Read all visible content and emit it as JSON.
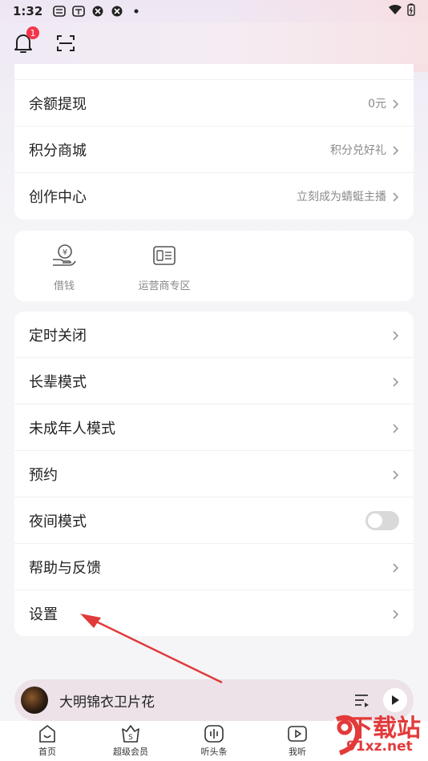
{
  "status_bar": {
    "time": "1:32"
  },
  "header": {
    "notification_count": "1"
  },
  "account_card": {
    "items": [
      {
        "label": "余额提现",
        "value": "0元"
      },
      {
        "label": "积分商城",
        "value": "积分兑好礼"
      },
      {
        "label": "创作中心",
        "value": "立刻成为蜻蜓主播"
      }
    ]
  },
  "services": {
    "items": [
      {
        "label": "借钱",
        "icon": "loan-icon"
      },
      {
        "label": "运营商专区",
        "icon": "carrier-icon"
      }
    ]
  },
  "settings_card": {
    "items": [
      {
        "label": "定时关闭"
      },
      {
        "label": "长辈模式"
      },
      {
        "label": "未成年人模式"
      },
      {
        "label": "预约"
      },
      {
        "label": "夜间模式",
        "toggle": false
      },
      {
        "label": "帮助与反馈"
      },
      {
        "label": "设置"
      }
    ]
  },
  "player": {
    "title": "大明锦衣卫片花"
  },
  "tabbar": {
    "items": [
      {
        "label": "首页"
      },
      {
        "label": "超级会员"
      },
      {
        "label": "听头条"
      },
      {
        "label": "我听"
      }
    ]
  },
  "watermark": {
    "text_top": "下载站",
    "text_bottom": "91xz.net",
    "mark": "9"
  },
  "colors": {
    "accent": "#f5344a",
    "annotation_arrow": "#e03a3a"
  }
}
